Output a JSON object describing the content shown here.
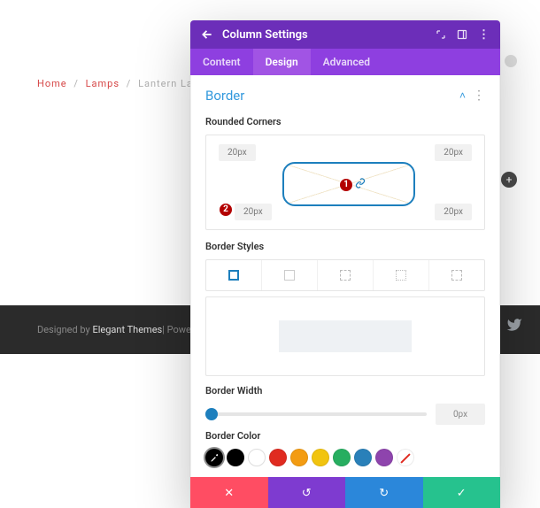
{
  "breadcrumb": {
    "home": "Home",
    "cat": "Lamps",
    "leaf": "Lantern Lamp"
  },
  "footer": {
    "prefix": "Designed by",
    "brand": "Elegant Themes",
    "suffix": " | Powered by"
  },
  "modal": {
    "title": "Column Settings",
    "tabs": {
      "content": "Content",
      "design": "Design",
      "advanced": "Advanced"
    },
    "section": "Border",
    "rounded_label": "Rounded Corners",
    "corners": {
      "tl": "20px",
      "tr": "20px",
      "bl": "20px",
      "br": "20px"
    },
    "markers": {
      "m1": "1",
      "m2": "2"
    },
    "styles_label": "Border Styles",
    "width_label": "Border Width",
    "width_value": "0px",
    "color_label": "Border Color",
    "colors": {
      "black": "#000000",
      "white": "#ffffff",
      "red": "#e02b20",
      "orange": "#f39c12",
      "yellow": "#f1c40f",
      "green": "#27ae60",
      "blue": "#2980b9",
      "purple": "#8e44ad"
    }
  },
  "icons": {
    "back": "↶",
    "expand": "⤢",
    "panel": "▤",
    "more": "⋮",
    "twitter": "twitter",
    "plus": "+",
    "link": "🔗",
    "caret": "˄",
    "cancel": "✕",
    "undo": "↺",
    "redo": "↻",
    "ok": "✓",
    "eyedrop": "✎"
  }
}
